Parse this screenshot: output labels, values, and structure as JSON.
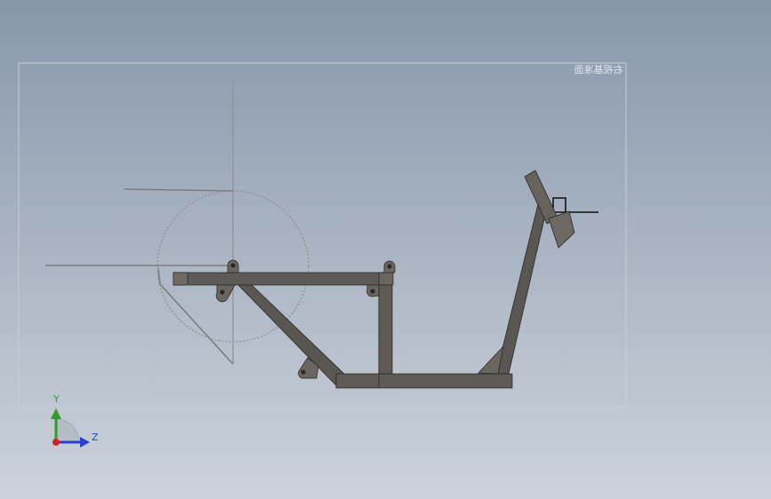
{
  "viewport": {
    "background_top": "#8797ab",
    "background_bottom": "#ccd2da"
  },
  "plane": {
    "label": "右视基准面"
  },
  "triad": {
    "y_label": "Y",
    "z_label": "Z",
    "y_color": "#2f9b2f",
    "z_color": "#2a3fcf",
    "origin_color": "#d62020"
  },
  "model": {
    "frame_color": "#5e5a55",
    "sketch_color": "#7d7d7d"
  }
}
